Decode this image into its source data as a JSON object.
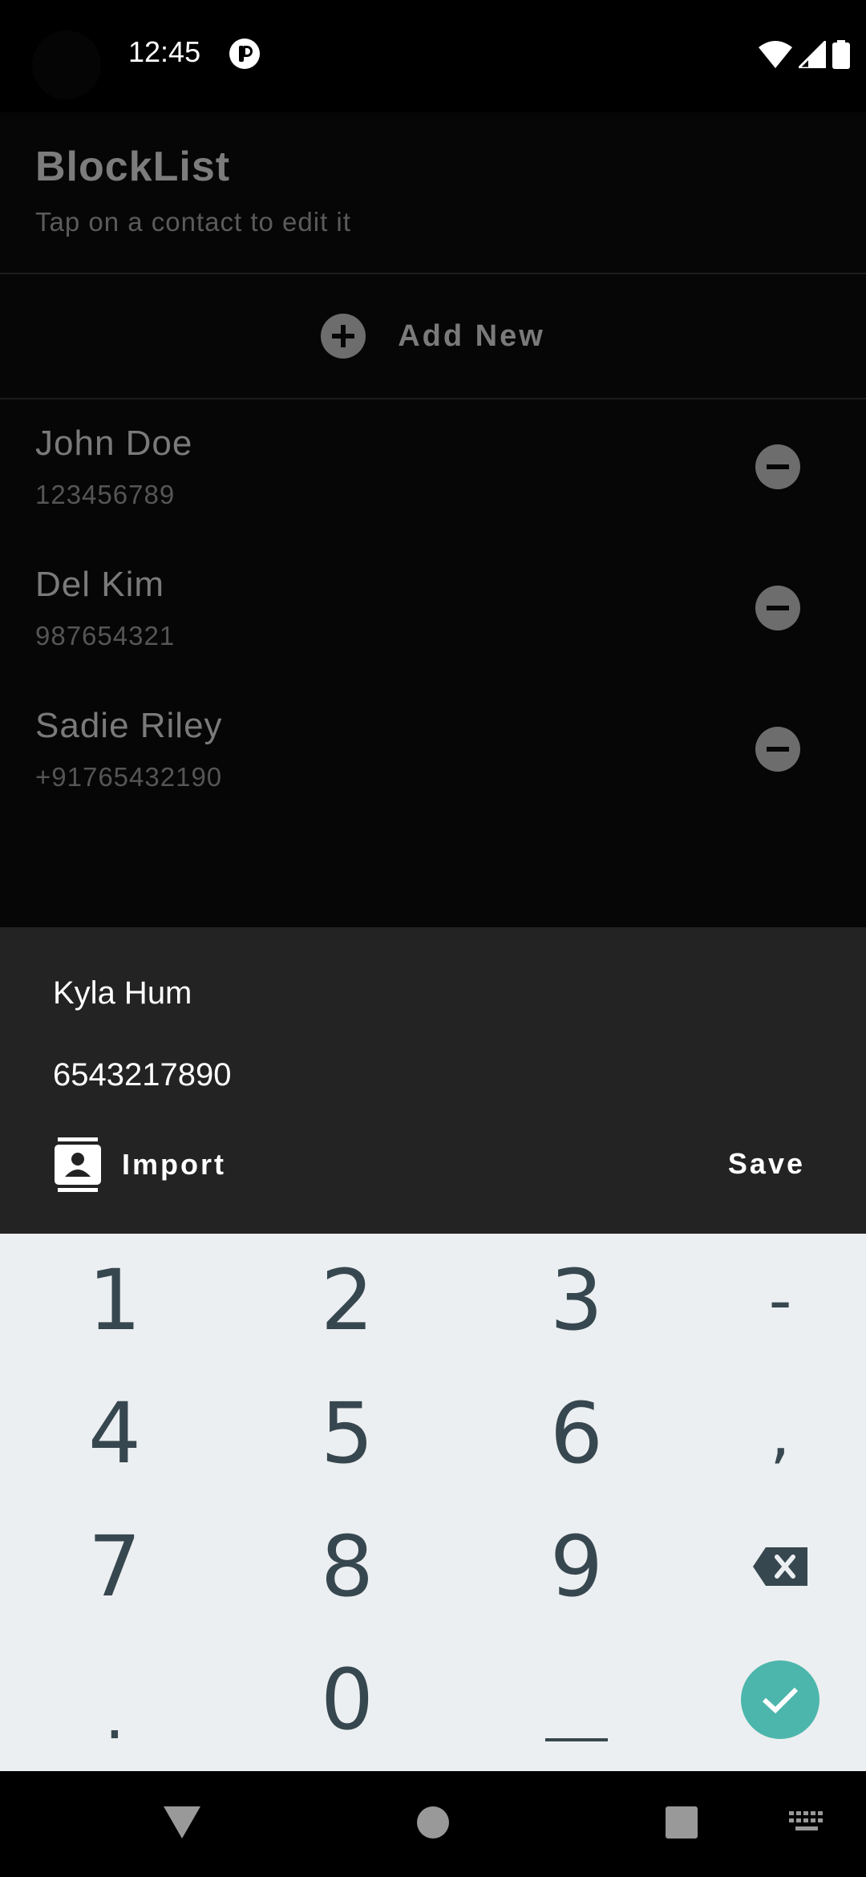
{
  "status_bar": {
    "time": "12:45",
    "icons": [
      "notification-icon",
      "wifi-icon",
      "cellular-signal-icon",
      "battery-icon"
    ]
  },
  "app": {
    "title": "BlockList",
    "subtitle": "Tap on a contact to edit it",
    "add_new_label": "Add New",
    "contacts": [
      {
        "name": "John Doe",
        "phone": "123456789"
      },
      {
        "name": "Del Kim",
        "phone": "987654321"
      },
      {
        "name": "Sadie Riley",
        "phone": "+91765432190"
      }
    ]
  },
  "sheet": {
    "name_value": "Kyla Hum",
    "phone_value": "6543217890",
    "import_label": "Import",
    "save_label": "Save"
  },
  "keyboard": {
    "keys": [
      "1",
      "2",
      "3",
      "-",
      "4",
      "5",
      "6",
      ",",
      "7",
      "8",
      "9",
      "backspace",
      ".",
      "0",
      "_",
      "done"
    ]
  },
  "colors": {
    "sheet_background": "#232323",
    "keyboard_background": "#eceff1",
    "key_text": "#37474f",
    "done_key": "#4db6ac"
  }
}
